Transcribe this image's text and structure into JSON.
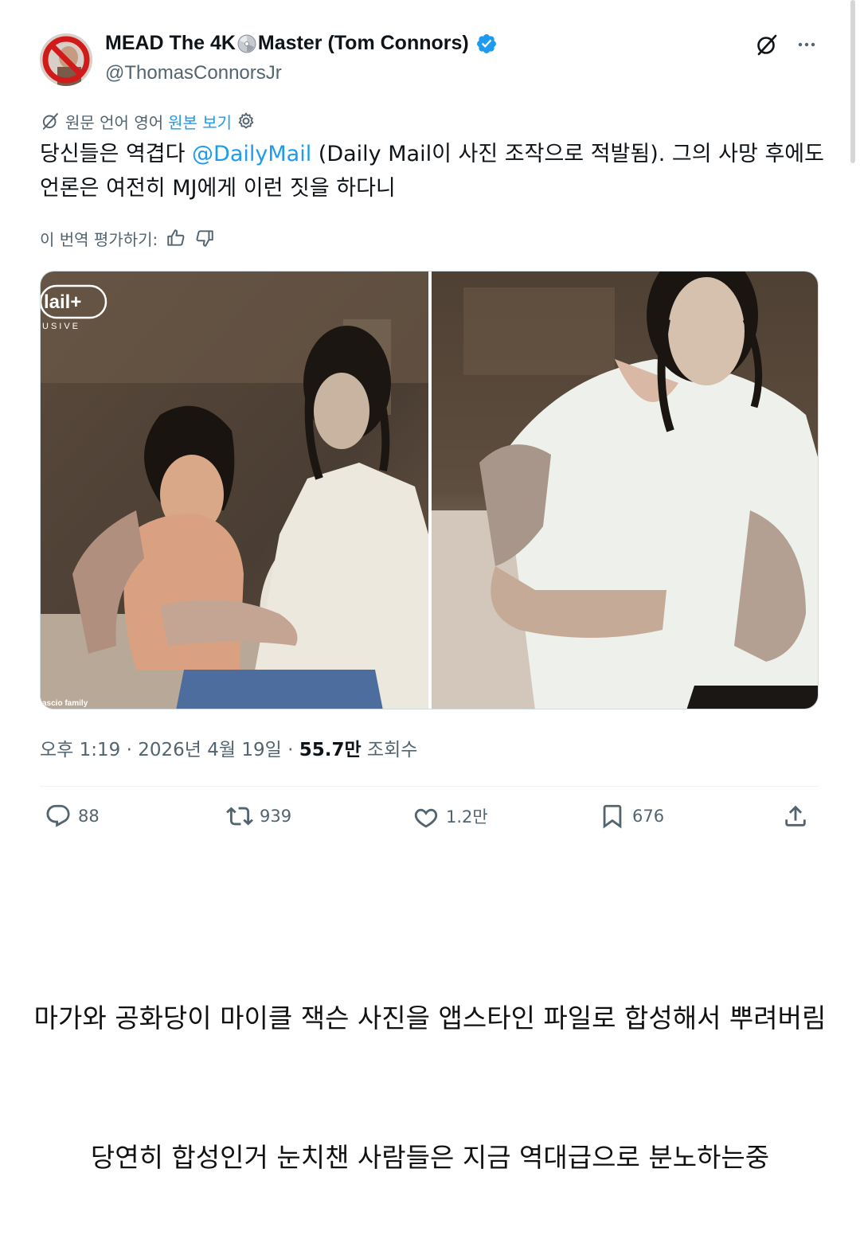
{
  "tweet": {
    "display_name_part1": "MEAD The 4K",
    "display_name_part2": "Master (Tom Connors)",
    "handle": "@ThomasConnorsJr",
    "translation": {
      "label": "원문 언어 영어",
      "show_original": "원본 보기"
    },
    "text_before_mention": "당신들은 역겹다 ",
    "mention": "@DailyMail",
    "text_after_mention": " (Daily Mail이 사진 조작으로 적발됨). 그의 사망 후에도 언론은 여전히 MJ에게 이런 짓을 하다니",
    "rate_translation": "이 번역 평가하기:",
    "media": {
      "left_watermark_top": "lail+",
      "left_watermark_sub": "USIVE",
      "left_credit": "ascio family"
    },
    "meta": {
      "time": "오후 1:19",
      "date": "2026년 4월 19일",
      "views_count": "55.7만",
      "views_label": "조회수"
    },
    "actions": {
      "replies": "88",
      "reposts": "939",
      "likes": "1.2만",
      "bookmarks": "676"
    }
  },
  "captions": {
    "line1": "마가와 공화당이 마이클 잭슨 사진을 앱스타인 파일로 합성해서 뿌려버림",
    "line2": "당연히 합성인거 눈치챈 사람들은 지금 역대급으로 분노하는중"
  },
  "colors": {
    "accent": "#1d9bf0",
    "secondary_text": "#536471",
    "primary_text": "#0f1419"
  }
}
